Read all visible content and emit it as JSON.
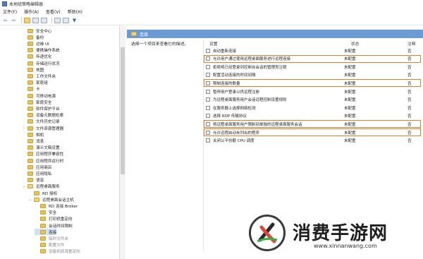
{
  "window": {
    "title": "本地组策略编辑器"
  },
  "menu": [
    "文件(F)",
    "操作(A)",
    "查看(V)",
    "帮助(H)"
  ],
  "toolbar": {
    "back_glyph": "⇦",
    "forward_glyph": "⇨",
    "filter_glyph": "▼",
    "icons": [
      "back-icon",
      "forward-icon",
      "up-folder-icon",
      "show-hide-tree-icon",
      "export-icon",
      "help-icon",
      "properties-icon",
      "filter-icon"
    ]
  },
  "tree": {
    "items": [
      {
        "label": "安全中心",
        "indent": 1,
        "expander": ""
      },
      {
        "label": "备份",
        "indent": 1,
        "expander": ""
      },
      {
        "label": "边缘 UI",
        "indent": 1,
        "expander": ""
      },
      {
        "label": "便携操作系统",
        "indent": 1,
        "expander": ""
      },
      {
        "label": "传递优化",
        "indent": 1,
        "expander": ""
      },
      {
        "label": "存储运行状况",
        "indent": 1,
        "expander": ""
      },
      {
        "label": "地图",
        "indent": 1,
        "expander": ""
      },
      {
        "label": "工作文件夹",
        "indent": 1,
        "expander": ""
      },
      {
        "label": "家庭组",
        "indent": 1,
        "expander": ""
      },
      {
        "label": "卡",
        "indent": 1,
        "expander": ""
      },
      {
        "label": "可移动电源",
        "indent": 1,
        "expander": ""
      },
      {
        "label": "家庭安全",
        "indent": 1,
        "expander": ""
      },
      {
        "label": "软件保护平台",
        "indent": 1,
        "expander": ""
      },
      {
        "label": "设备元数据检索",
        "indent": 1,
        "expander": ""
      },
      {
        "label": "文件历史记录",
        "indent": 1,
        "expander": ""
      },
      {
        "label": "文件资源管理器",
        "indent": 1,
        "expander": "›"
      },
      {
        "label": "相机",
        "indent": 1,
        "expander": ""
      },
      {
        "label": "消息",
        "indent": 1,
        "expander": ""
      },
      {
        "label": "演示文稿设置",
        "indent": 1,
        "expander": ""
      },
      {
        "label": "应用程序兼容性",
        "indent": 1,
        "expander": ""
      },
      {
        "label": "应用程序运行时",
        "indent": 1,
        "expander": ""
      },
      {
        "label": "应用商店",
        "indent": 1,
        "expander": ""
      },
      {
        "label": "应用隐私",
        "indent": 1,
        "expander": ""
      },
      {
        "label": "语音",
        "indent": 1,
        "expander": ""
      },
      {
        "label": "远程桌面服务",
        "indent": 1,
        "expander": "⌄",
        "open": true
      },
      {
        "label": "RD 授权",
        "indent": 2,
        "expander": ""
      },
      {
        "label": "远程桌面会话主机",
        "indent": 2,
        "expander": "⌄",
        "open": true
      },
      {
        "label": "RD 连接 Broker",
        "indent": 3,
        "expander": ""
      },
      {
        "label": "安全",
        "indent": 3,
        "expander": ""
      },
      {
        "label": "打印机重定向",
        "indent": 3,
        "expander": ""
      },
      {
        "label": "会话时间限制",
        "indent": 3,
        "expander": ""
      },
      {
        "label": "连接",
        "indent": 3,
        "expander": "",
        "selected": true
      },
      {
        "label": "临时文件夹",
        "indent": 3,
        "expander": "",
        "dim": true
      },
      {
        "label": "配置文件",
        "indent": 3,
        "expander": "",
        "dim": true
      },
      {
        "label": "设备和资源重定向",
        "indent": 3,
        "expander": "",
        "dim": true
      }
    ]
  },
  "pane": {
    "header": "连接",
    "description": "选择一个项目来查看它的描述。",
    "columns": {
      "setting": "设置",
      "state": "状态",
      "note": "注释"
    },
    "rows": [
      {
        "setting": "自动重新连接",
        "state": "未配置",
        "note": "否",
        "highlight": false
      },
      {
        "setting": "允许用户通过使用远程桌面服务进行远程连接",
        "state": "未配置",
        "note": "否",
        "highlight": true
      },
      {
        "setting": "拒绝将已经登录到控制台会话的管理员注销",
        "state": "未配置",
        "note": "否",
        "highlight": false
      },
      {
        "setting": "配置活动连接的时间间隔",
        "state": "未配置",
        "note": "否",
        "highlight": false
      },
      {
        "setting": "限制连接的数量",
        "state": "未配置",
        "note": "否",
        "highlight": true
      },
      {
        "setting": "暂停用户登录以供远程注册",
        "state": "未配置",
        "note": "否",
        "highlight": false
      },
      {
        "setting": "为远程桌面服务用户会话远程控制设置规则",
        "state": "未配置",
        "note": "否",
        "highlight": false
      },
      {
        "setting": "在服务器上选择网络检测",
        "state": "未配置",
        "note": "否",
        "highlight": false
      },
      {
        "setting": "选择 RDP 传输协议",
        "state": "未配置",
        "note": "否",
        "highlight": false
      },
      {
        "setting": "将远程桌面服务用户限制到单独的远程桌面服务会话",
        "state": "未配置",
        "note": "否",
        "highlight": true
      },
      {
        "setting": "允许远程启动未列出的程序",
        "state": "未配置",
        "note": "否",
        "highlight": true
      },
      {
        "setting": "关闭公平份额 CPU 调度",
        "state": "未配置",
        "note": "否",
        "highlight": false
      }
    ]
  },
  "watermark": {
    "name": "消费手游网",
    "url": "www.xinnanwang.com"
  },
  "colors": {
    "header_blue": "#6b9bd2",
    "highlight_orange": "#e07d2e",
    "folder_yellow": "#e8c15a"
  }
}
